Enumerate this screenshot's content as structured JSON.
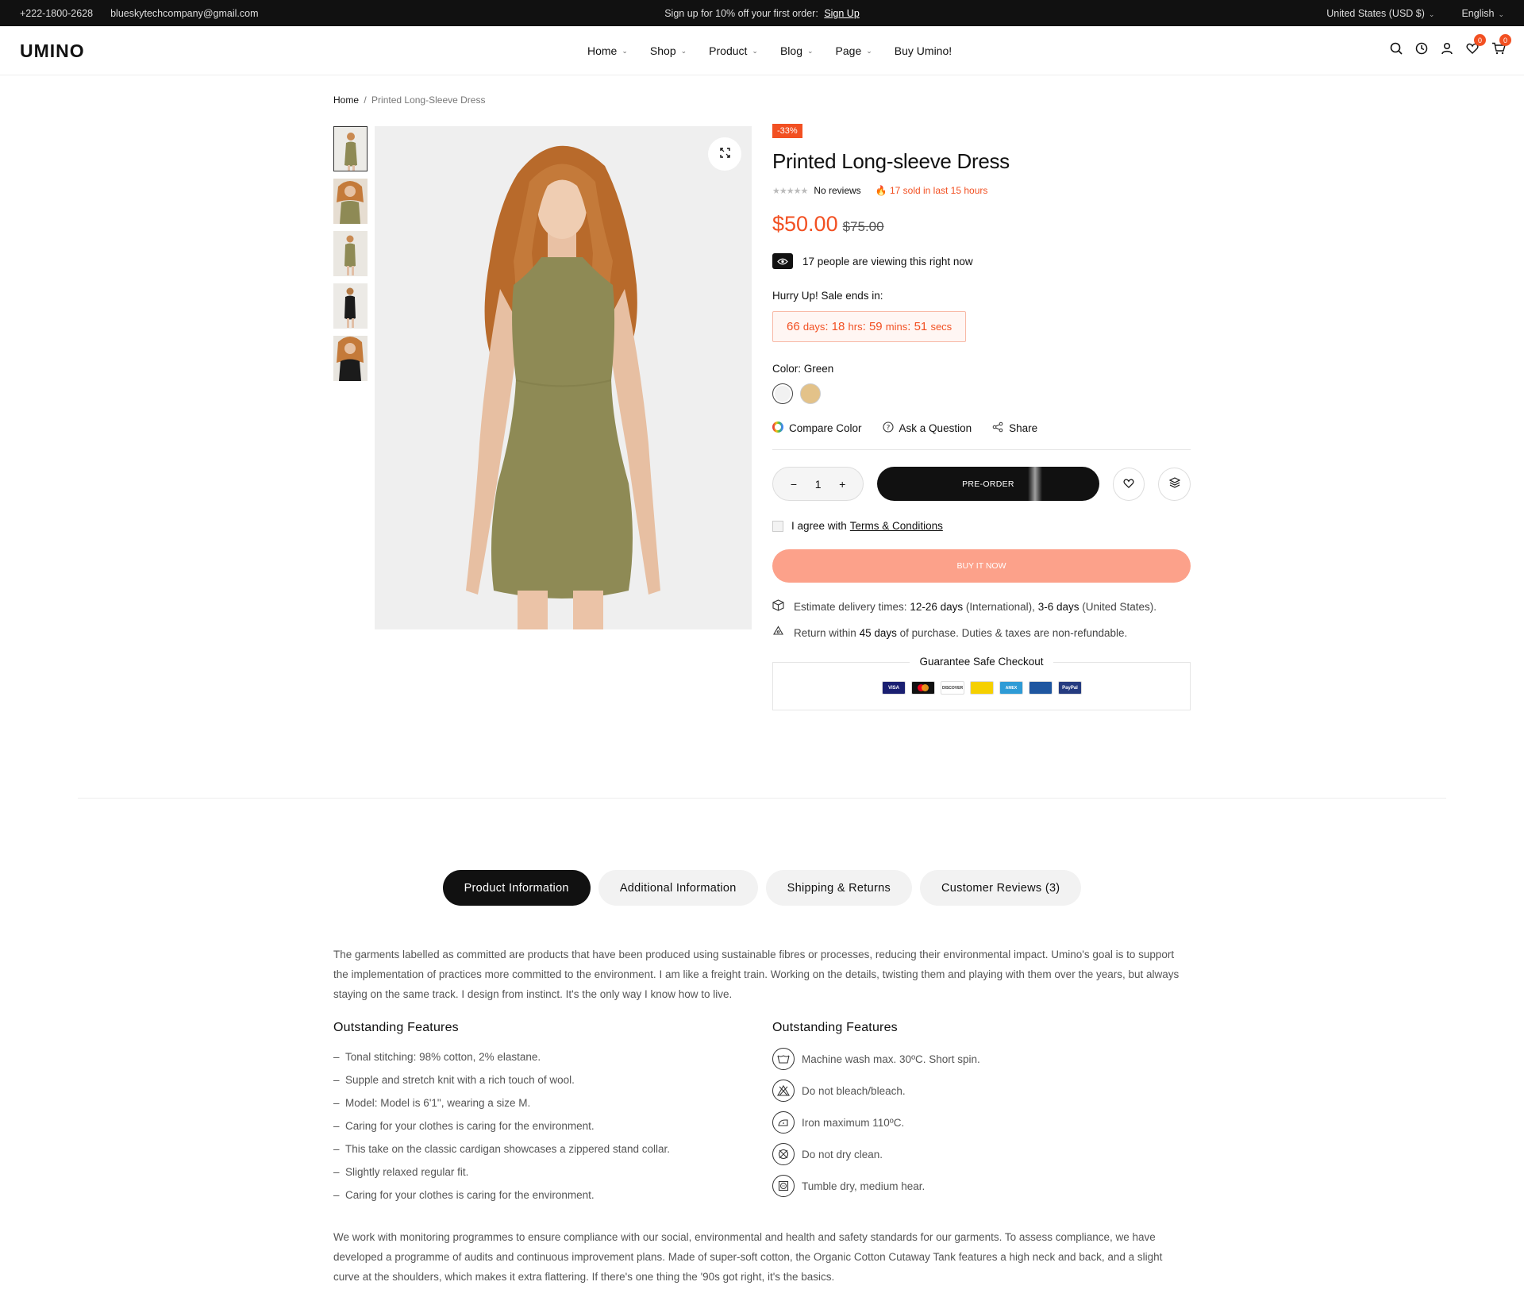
{
  "topbar": {
    "phone": "+222-1800-2628",
    "email": "blueskytechcompany@gmail.com",
    "promo_text": "Sign up for 10% off your first order:",
    "promo_link": "Sign Up",
    "currency": "United States (USD $)",
    "language": "English"
  },
  "header": {
    "logo": "UMINO",
    "nav": [
      "Home",
      "Shop",
      "Product",
      "Blog",
      "Page",
      "Buy Umino!"
    ],
    "wishlist_count": "0",
    "cart_count": "0"
  },
  "breadcrumb": {
    "home": "Home",
    "separator": "/",
    "current": "Printed Long-Sleeve Dress"
  },
  "product": {
    "discount_tag": "-33%",
    "title": "Printed Long-sleeve Dress",
    "stars": "★★★★★",
    "reviews": "No reviews",
    "sold": "17 sold in last 15 hours",
    "price": "$50.00",
    "old_price": "$75.00",
    "viewing": "17 people are viewing this right now",
    "hurry": "Hurry Up! Sale ends in:",
    "countdown": {
      "days": "66",
      "days_label": "days",
      "hrs": "18",
      "hrs_label": "hrs",
      "mins": "59",
      "mins_label": "mins",
      "secs": "51",
      "secs_label": "secs"
    },
    "color_label": "Color:",
    "color_value": "Green",
    "swatch_colors": [
      "#f1f1f1",
      "#e3c289"
    ],
    "compare_color": "Compare Color",
    "ask_question": "Ask a Question",
    "share": "Share",
    "quantity": "1",
    "minus": "−",
    "plus": "+",
    "preorder": "PRE-ORDER",
    "agree_text": "I agree with",
    "terms": "Terms & Conditions",
    "buy_now": "BUY IT NOW",
    "delivery_prefix": "Estimate delivery times:",
    "delivery_intl": "12-26 days",
    "delivery_intl_note": "(International),",
    "delivery_us": "3-6 days",
    "delivery_us_note": "(United States).",
    "return_prefix": "Return within",
    "return_days": "45 days",
    "return_suffix": "of purchase. Duties & taxes are non-refundable.",
    "checkout_title": "Guarantee Safe Checkout",
    "payment_cards": [
      "VISA",
      "MC",
      "DISCOVER",
      "",
      "AMEX",
      "",
      "PayPal"
    ]
  },
  "colors": {
    "accent": "#f25022",
    "buy_now_bg": "#fca18a",
    "dark": "#111111"
  },
  "tabs": [
    "Product Information",
    "Additional Information",
    "Shipping & Returns",
    "Customer Reviews (3)"
  ],
  "description": {
    "intro": "The garments labelled as committed are products that have been produced using sustainable fibres or processes, reducing their environmental impact. Umino's goal is to support the implementation of practices more committed to the environment. I am like a freight train. Working on the details, twisting them and playing with them over the years, but always staying on the same track. I design from instinct. It's the only way I know how to live.",
    "features_title_left": "Outstanding Features",
    "features_left": [
      "Tonal stitching: 98% cotton, 2% elastane.",
      "Supple and stretch knit with a rich touch of wool.",
      "Model:  Model is 6'1\", wearing a size M.",
      "Caring for your clothes is caring for the environment.",
      "This take on the classic cardigan showcases a zippered stand collar.",
      "Slightly relaxed regular fit.",
      "Caring for your clothes is caring for the environment."
    ],
    "features_title_right": "Outstanding Features",
    "care": [
      "Machine wash max. 30ºC. Short spin.",
      "Do not bleach/bleach.",
      "Iron maximum 110ºC.",
      "Do not dry clean.",
      "Tumble dry, medium hear."
    ],
    "outro": "We work with monitoring programmes to ensure compliance with our social, environmental and health and safety standards for our garments. To assess compliance, we have developed a programme of audits and continuous improvement plans. Made of super-soft cotton, the Organic Cotton Cutaway Tank features a high neck and back, and a slight curve at the shoulders, which makes it extra flattering. If there's one thing the '90s got right, it's the basics."
  }
}
